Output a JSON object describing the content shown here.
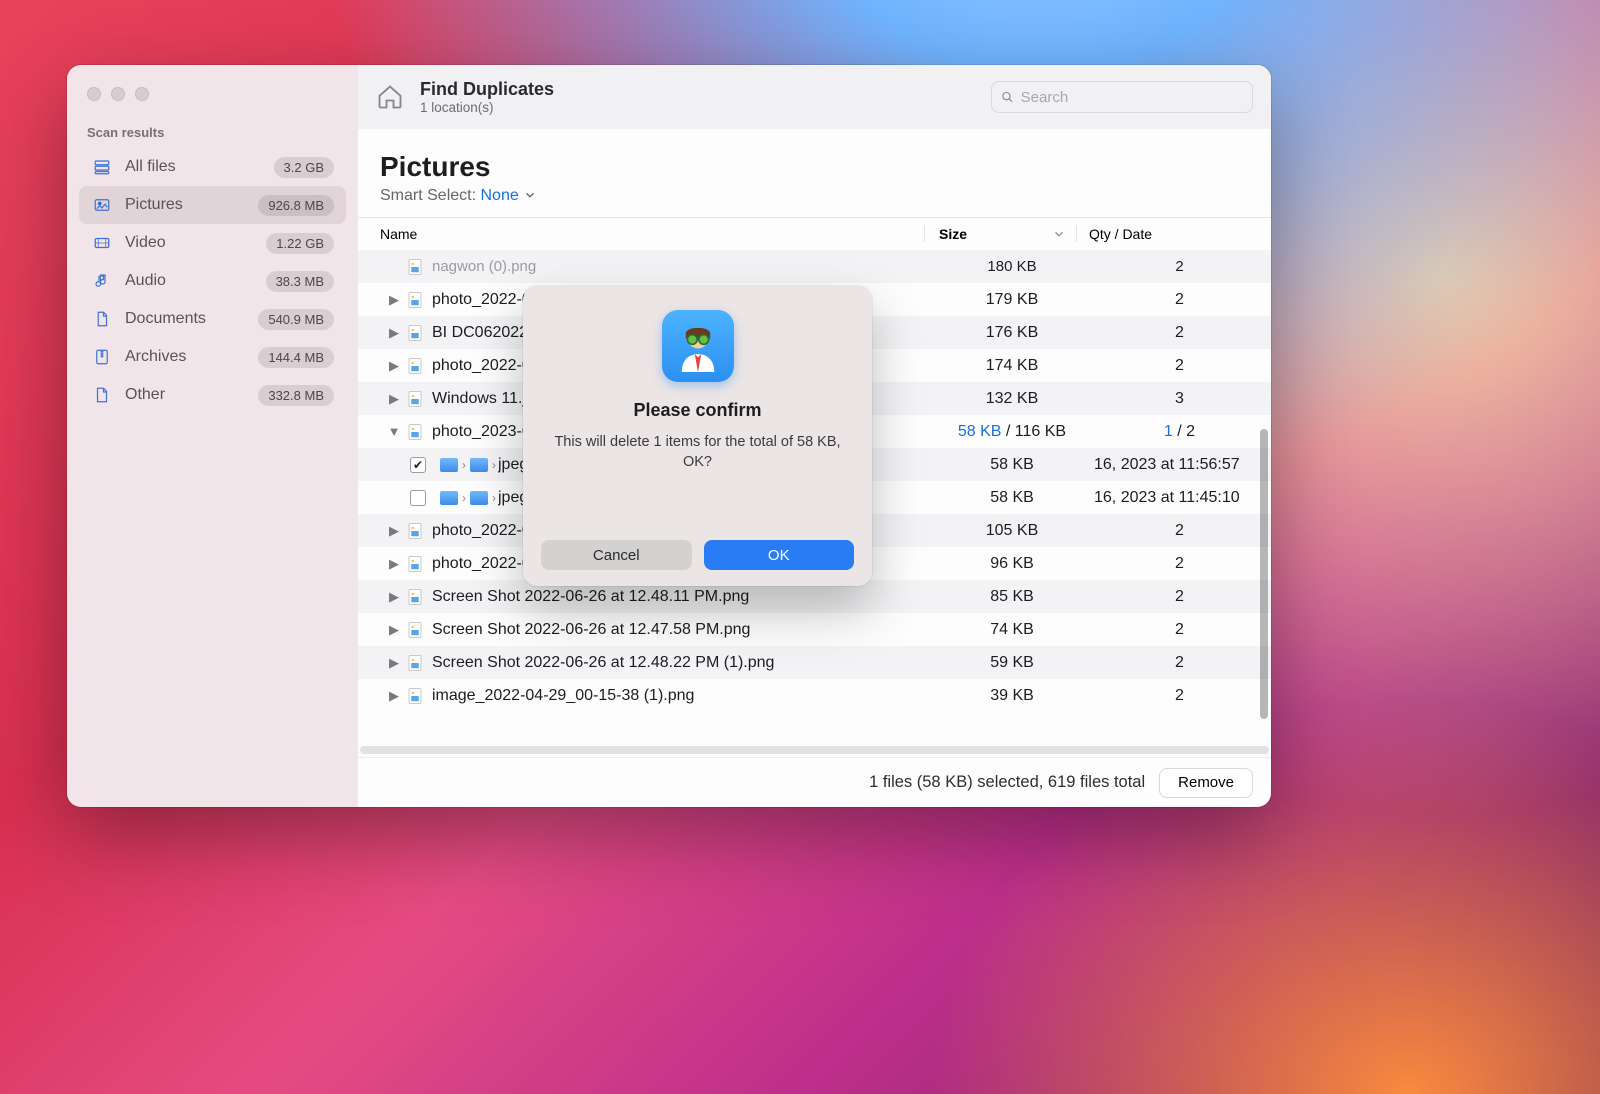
{
  "toolbar": {
    "title": "Find Duplicates",
    "subtitle": "1 location(s)",
    "search_placeholder": "Search"
  },
  "sidebar": {
    "section": "Scan results",
    "items": [
      {
        "label": "All files",
        "badge": "3.2 GB",
        "icon": "stack"
      },
      {
        "label": "Pictures",
        "badge": "926.8 MB",
        "icon": "picture",
        "selected": true
      },
      {
        "label": "Video",
        "badge": "1.22 GB",
        "icon": "video"
      },
      {
        "label": "Audio",
        "badge": "38.3 MB",
        "icon": "audio"
      },
      {
        "label": "Documents",
        "badge": "540.9 MB",
        "icon": "document"
      },
      {
        "label": "Archives",
        "badge": "144.4 MB",
        "icon": "archive"
      },
      {
        "label": "Other",
        "badge": "332.8 MB",
        "icon": "other"
      }
    ]
  },
  "heading": {
    "title": "Pictures",
    "smart_label": "Smart Select:",
    "smart_value": "None"
  },
  "columns": {
    "name": "Name",
    "size": "Size",
    "qty": "Qty / Date"
  },
  "rows": [
    {
      "type": "partial",
      "name": "nagwon (0).png",
      "size": "180 KB",
      "qty": "2"
    },
    {
      "type": "group",
      "name": "photo_2022-0",
      "size": "179 KB",
      "qty": "2"
    },
    {
      "type": "group",
      "name": "BI DC062022",
      "size": "176 KB",
      "qty": "2"
    },
    {
      "type": "group",
      "name": "photo_2022-0",
      "size": "174 KB",
      "qty": "2"
    },
    {
      "type": "group",
      "name": "Windows 11.jp",
      "size": "132 KB",
      "qty": "3"
    },
    {
      "type": "expanded",
      "name": "photo_2023-0",
      "size_sel": "58 KB",
      "size_tot": " / 116 KB",
      "qty_sel": "1",
      "qty_tot": " / 2"
    },
    {
      "type": "child",
      "checked": true,
      "ext": "jpeg",
      "size": "58 KB",
      "date": "16, 2023 at 11:56:57"
    },
    {
      "type": "child",
      "checked": false,
      "ext": "jpeg",
      "size": "58 KB",
      "date": "16, 2023 at 11:45:10"
    },
    {
      "type": "group",
      "name": "photo_2022-0",
      "size": "105 KB",
      "qty": "2"
    },
    {
      "type": "group",
      "name": "photo_2022-0",
      "size": "96 KB",
      "qty": "2"
    },
    {
      "type": "group",
      "name": "Screen Shot 2022-06-26 at 12.48.11 PM.png",
      "size": "85 KB",
      "qty": "2"
    },
    {
      "type": "group",
      "name": "Screen Shot 2022-06-26 at 12.47.58 PM.png",
      "size": "74 KB",
      "qty": "2"
    },
    {
      "type": "group",
      "name": "Screen Shot 2022-06-26 at 12.48.22 PM (1).png",
      "size": "59 KB",
      "qty": "2"
    },
    {
      "type": "group",
      "name": "image_2022-04-29_00-15-38 (1).png",
      "size": "39 KB",
      "qty": "2"
    }
  ],
  "footer": {
    "status": "1 files (58 KB) selected, 619 files total",
    "remove": "Remove"
  },
  "dialog": {
    "title": "Please confirm",
    "message": "This will delete 1 items for the total of 58 KB, OK?",
    "cancel": "Cancel",
    "ok": "OK"
  }
}
